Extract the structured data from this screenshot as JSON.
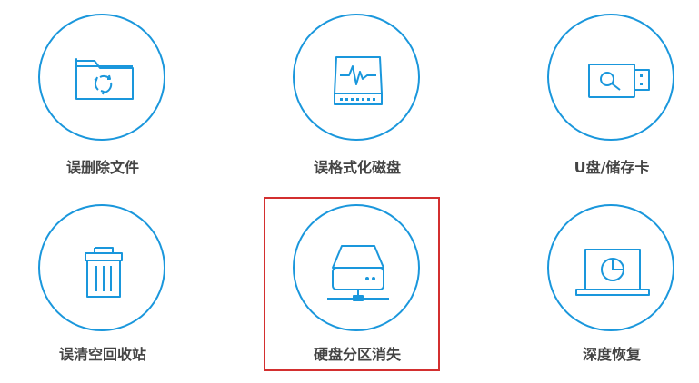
{
  "accent_color": "#1a97dc",
  "selection_color": "#d32f2f",
  "options": [
    {
      "label": "误删除文件",
      "icon": "folder-recycle-icon"
    },
    {
      "label": "误格式化磁盘",
      "icon": "disk-pulse-icon"
    },
    {
      "label": "U盘/储存卡",
      "icon": "usb-drive-search-icon"
    },
    {
      "label": "误清空回收站",
      "icon": "trash-bin-icon"
    },
    {
      "label": "硬盘分区消失",
      "icon": "network-drive-icon",
      "selected": true
    },
    {
      "label": "深度恢复",
      "icon": "laptop-scan-icon"
    }
  ]
}
